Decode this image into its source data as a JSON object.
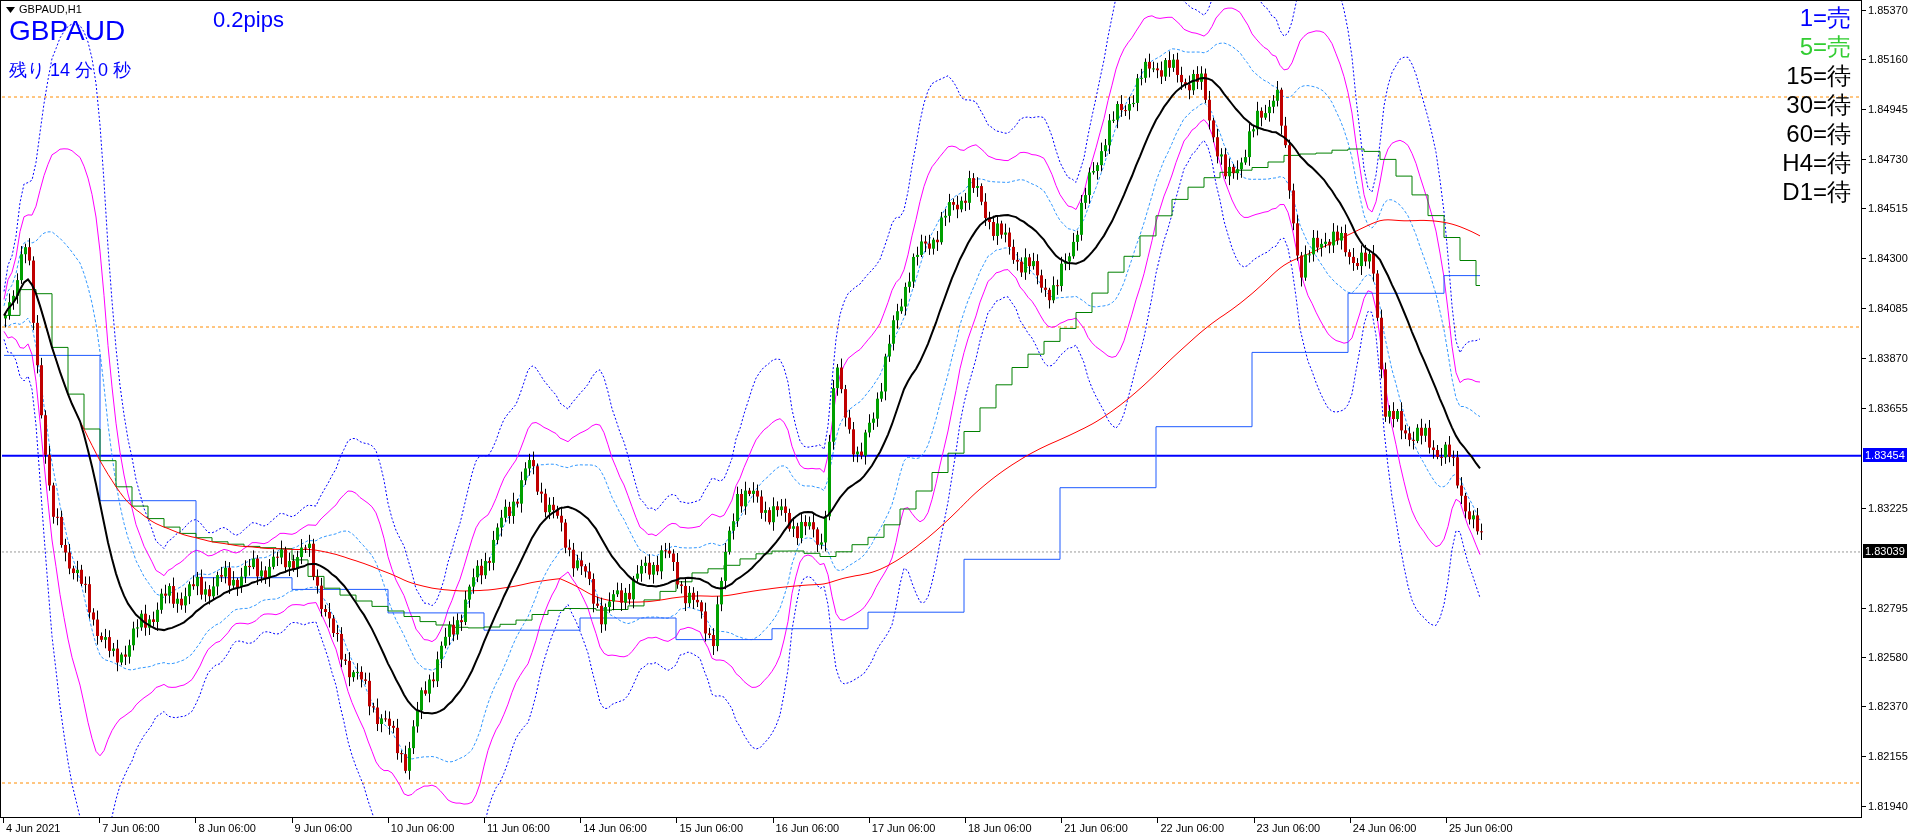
{
  "chart": {
    "title": "GBPAUD,H1",
    "symbol": "GBPAUD",
    "spread": "0.2pips",
    "remaining": "残り 14 分 0 秒",
    "signals": [
      {
        "label": "1=売",
        "color": "#0000ff"
      },
      {
        "label": "5=売",
        "color": "#32cd32"
      },
      {
        "label": "15=待",
        "color": "#000000"
      },
      {
        "label": "30=待",
        "color": "#000000"
      },
      {
        "label": "60=待",
        "color": "#000000"
      },
      {
        "label": "H4=待",
        "color": "#000000"
      },
      {
        "label": "D1=待",
        "color": "#000000"
      }
    ]
  },
  "price_axis": {
    "ticks": [
      "1.85370",
      "1.85160",
      "1.84945",
      "1.84730",
      "1.84515",
      "1.84300",
      "1.84085",
      "1.83870",
      "1.83655",
      "1.83225",
      "1.82795",
      "1.82580",
      "1.82370",
      "1.82155",
      "1.81940"
    ],
    "markers": [
      {
        "label": "1.83454",
        "color": "#0000ff"
      },
      {
        "label": "1.83039",
        "color": "#000000"
      }
    ]
  },
  "time_axis": {
    "labels": [
      "4 Jun 2021",
      "7 Jun 06:00",
      "8 Jun 06:00",
      "9 Jun 06:00",
      "10 Jun 06:00",
      "11 Jun 06:00",
      "14 Jun 06:00",
      "15 Jun 06:00",
      "16 Jun 06:00",
      "17 Jun 06:00",
      "18 Jun 06:00",
      "21 Jun 06:00",
      "22 Jun 06:00",
      "23 Jun 06:00",
      "24 Jun 06:00",
      "25 Jun 06:00"
    ]
  }
}
